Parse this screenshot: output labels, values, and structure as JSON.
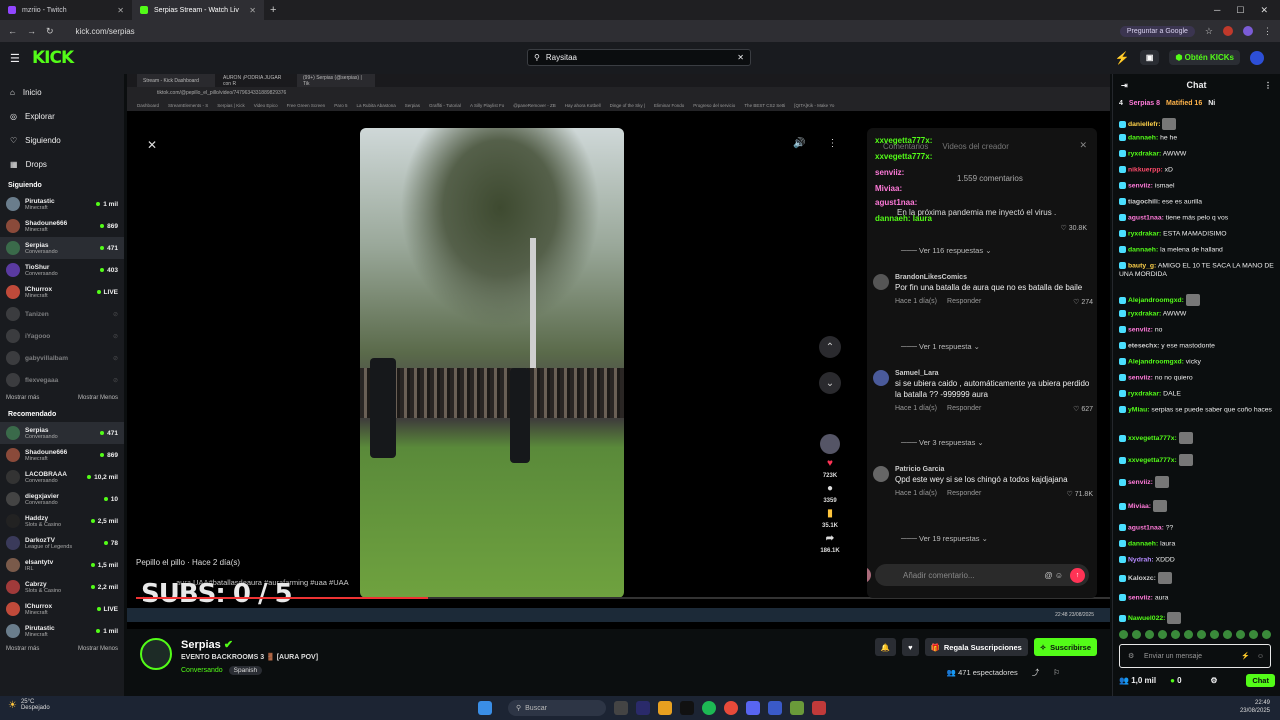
{
  "browser": {
    "tabs": [
      {
        "label": "mzriio - Twitch",
        "color": "#9146ff"
      },
      {
        "label": "Serpias Stream - Watch Liv",
        "color": "#53fc18"
      }
    ],
    "url": "kick.com/serpias",
    "google_label": "Preguntar a Google"
  },
  "kick": {
    "logo": "KICK",
    "search_value": "Raysitaa",
    "get_kicks": "Obtén KICKs"
  },
  "sidebar": {
    "nav": [
      {
        "label": "Inicio",
        "icon": "home-icon"
      },
      {
        "label": "Explorar",
        "icon": "compass-icon"
      },
      {
        "label": "Siguiendo",
        "icon": "heart-icon"
      },
      {
        "label": "Drops",
        "icon": "gift-icon"
      }
    ],
    "following_title": "Siguiendo",
    "following": [
      {
        "name": "Pirutastic",
        "cat": "Minecraft",
        "viewers": "1 mil",
        "color": "#6a7d8c",
        "dim": false
      },
      {
        "name": "Shadoune666",
        "cat": "Minecraft",
        "viewers": "869",
        "color": "#8a4a3a",
        "dim": false
      },
      {
        "name": "Serpias",
        "cat": "Conversando",
        "viewers": "471",
        "color": "#3a6a4a",
        "dim": false,
        "sel": true
      },
      {
        "name": "TioShur",
        "cat": "Conversando",
        "viewers": "403",
        "color": "#5a3aa0",
        "dim": false
      },
      {
        "name": "IChurrox",
        "cat": "Minecraft",
        "viewers": "LIVE",
        "color": "#c04a3a",
        "dim": false
      },
      {
        "name": "Tanizen",
        "cat": "",
        "viewers": "",
        "color": "#666",
        "dim": true
      },
      {
        "name": "iYagooo",
        "cat": "",
        "viewers": "",
        "color": "#666",
        "dim": true
      },
      {
        "name": "gabyvillalbam",
        "cat": "",
        "viewers": "",
        "color": "#666",
        "dim": true
      },
      {
        "name": "flexvegaaa",
        "cat": "",
        "viewers": "",
        "color": "#666",
        "dim": true
      }
    ],
    "more": "Mostrar más",
    "less": "Mostrar Menos",
    "recommended_title": "Recomendado",
    "recommended": [
      {
        "name": "Serpias",
        "cat": "Conversando",
        "viewers": "471",
        "color": "#3a6a4a",
        "sel": true
      },
      {
        "name": "Shadoune666",
        "cat": "Minecraft",
        "viewers": "869",
        "color": "#8a4a3a"
      },
      {
        "name": "LACOBRAAA",
        "cat": "Conversando",
        "viewers": "10,2 mil",
        "color": "#333"
      },
      {
        "name": "diegxjavier",
        "cat": "Conversando",
        "viewers": "10",
        "color": "#444"
      },
      {
        "name": "Haddzy",
        "cat": "Slots & Casino",
        "viewers": "2,5 mil",
        "color": "#222"
      },
      {
        "name": "DarkozTV",
        "cat": "League of Legends",
        "viewers": "78",
        "color": "#3a3a5a"
      },
      {
        "name": "elsantytv",
        "cat": "IRL",
        "viewers": "1,5 mil",
        "color": "#7a5a4a"
      },
      {
        "name": "Cabrzy",
        "cat": "Slots & Casino",
        "viewers": "2,2 mil",
        "color": "#a03a3a"
      },
      {
        "name": "IChurrox",
        "cat": "Minecraft",
        "viewers": "LIVE",
        "color": "#c04a3a"
      },
      {
        "name": "Pirutastic",
        "cat": "Minecraft",
        "viewers": "1 mil",
        "color": "#6a7d8c"
      }
    ]
  },
  "inner": {
    "tabs": [
      "Stream - Kick Dashboard",
      "AURON ¡PODRIA JUGAR con R",
      "(99+) Serpias (@serpias) | Tik"
    ],
    "url": "tiktok.com/@pepillo_el_pillo/video/7479634331889829376",
    "bookmarks": [
      "Dashboard",
      "StreamElements - S",
      "Serpias | Kick",
      "Video Epico",
      "Free Green Screen",
      "Paro 5",
      "La Rubita Abastona",
      "Serpias",
      "Graffiti - Tutorial",
      "A Silly Playlist Fo",
      "@paneRemover - ZB",
      "Hay ahora Kotbell",
      "Dinge of the Sky |",
      "Eliminar Fondo",
      "Progreso del servicio",
      "The BEST CS2 Setti",
      "[QITA]Kik - Make Yo"
    ]
  },
  "video": {
    "author": "Pepillo el pillo · Hace 2 día(s)",
    "caption": "aura UAA#batallasdeaura #aurafarming #uaa #UAA",
    "subs_overlay": "SUBS: 0 / 5",
    "likes": "723K",
    "comments_count": "3359",
    "saves": "35.1K",
    "shares": "186.1K",
    "mini_clock": "22:48 23/08/2025"
  },
  "comments_panel": {
    "tab_comments": "Comentarios",
    "tab_creator": "Videos del creador",
    "total": "1.559 comentarios",
    "overlay": [
      {
        "user": "xxvegetta777x:",
        "color": "#53fc18"
      },
      {
        "user": "xxvegetta777x:",
        "color": "#53fc18"
      },
      {
        "user": "senviiz:",
        "color": "#ff7ad9"
      },
      {
        "user": "Miviaa:",
        "color": "#ff7ad9"
      },
      {
        "user": "agust1naa:",
        "color": "#ff7ad9"
      },
      {
        "user": "dannaeh: laura",
        "color": "#53fc18"
      }
    ],
    "first_text": "En la próxima pandemia me inyectó el virus .",
    "first_like": "30.8K",
    "items": [
      {
        "replies": "Ver 116 respuestas"
      },
      {
        "user": "BrandonLikesComics",
        "text": "Por fin una batalla de aura que no es batalla de baile",
        "time": "Hace 1 día(s)",
        "reply": "Responder",
        "likes": "274",
        "more": "Ver 1 respuesta"
      },
      {
        "user": "Samuel_Lara",
        "text": "si se ubiera caido , automáticamente ya ubiera perdido la batalla ?? -999999 aura",
        "time": "Hace 1 día(s)",
        "reply": "Responder",
        "likes": "627",
        "more": "Ver 3 respuestas"
      },
      {
        "user": "Patricio Garcia",
        "text": "Qpd este wey si se los chingó a todos kajdjajana",
        "time": "Hace 1 día(s)",
        "reply": "Responder",
        "likes": "71.8K",
        "more": "Ver 19 respuestas"
      }
    ],
    "input_placeholder": "Añadir comentario..."
  },
  "stream": {
    "name": "Serpias",
    "title": "EVENTO BACKROOMS 3 🚪 [AURA POV]",
    "category": "Conversando",
    "language": "Spanish",
    "gift_subs": "Regala Suscripciones",
    "subscribe": "Suscribirse",
    "viewers": "471 espectadores"
  },
  "chat": {
    "title": "Chat",
    "pinned": [
      {
        "text": "4",
        "color": "#efeff1"
      },
      {
        "text": "Serpias 8",
        "color": "#ff7ad9"
      },
      {
        "text": "Matified 16",
        "color": "#ffb34a"
      },
      {
        "text": "Ni",
        "color": "#efeff1"
      }
    ],
    "messages": [
      {
        "user": "daniellefr:",
        "text": "",
        "color": "#ffd24a",
        "emote": true
      },
      {
        "user": "dannaeh:",
        "text": "he he",
        "color": "#53fc18"
      },
      {
        "user": "ryxdrakar:",
        "text": "AWWW",
        "color": "#53fc18"
      },
      {
        "user": "nikkuerpp:",
        "text": "xD",
        "color": "#ff4a6a"
      },
      {
        "user": "senviiz:",
        "text": "ismael",
        "color": "#ff7ad9"
      },
      {
        "user": "tiagochili:",
        "text": "ese es aurilla",
        "color": "#d0d0d0"
      },
      {
        "user": "agust1naa:",
        "text": "tiene más pelo q vos",
        "color": "#ff7ad9"
      },
      {
        "user": "ryxdrakar:",
        "text": "ESTA MAMADISIMO",
        "color": "#53fc18"
      },
      {
        "user": "dannaeh:",
        "text": "la melena de halland",
        "color": "#53fc18"
      },
      {
        "user": "bauty_g:",
        "text": "AMIGO EL 10 TE SACA LA MANO DE UNA MORDIDA",
        "color": "#ffd24a"
      },
      {
        "user": "Alejandroomgxd:",
        "text": "",
        "color": "#53fc18",
        "emote": true
      },
      {
        "user": "ryxdrakar:",
        "text": "AWWW",
        "color": "#53fc18"
      },
      {
        "user": "senviiz:",
        "text": "no",
        "color": "#ff7ad9"
      },
      {
        "user": "etesechx:",
        "text": "y ese mastodonte",
        "color": "#d0d0d0"
      },
      {
        "user": "Alejandroomgxd:",
        "text": "vicky",
        "color": "#53fc18"
      },
      {
        "user": "senviiz:",
        "text": "no no quiero",
        "color": "#ff7ad9"
      },
      {
        "user": "ryxdrakar:",
        "text": "DALE",
        "color": "#53fc18"
      },
      {
        "user": "yMiau:",
        "text": "serpias se puede saber que coño haces",
        "color": "#53fc18"
      },
      {
        "user": "xxvegetta777x:",
        "text": "",
        "color": "#53fc18",
        "emote": true
      },
      {
        "user": "xxvegetta777x:",
        "text": "",
        "color": "#53fc18",
        "emote": true
      },
      {
        "user": "senviiz:",
        "text": "",
        "color": "#ff7ad9",
        "emote": true
      },
      {
        "user": "Miviaa:",
        "text": "",
        "color": "#ff7ad9",
        "emote": true
      },
      {
        "user": "agust1naa:",
        "text": "??",
        "color": "#ff7ad9"
      },
      {
        "user": "dannaeh:",
        "text": "laura",
        "color": "#53fc18"
      },
      {
        "user": "Nydrah:",
        "text": "XDDD",
        "color": "#b48aff"
      },
      {
        "user": "Kaloxzc:",
        "text": "",
        "color": "#d0d0d0",
        "emote": true
      },
      {
        "user": "senviiz:",
        "text": "aura",
        "color": "#ff7ad9"
      },
      {
        "user": "Nawuel022:",
        "text": "",
        "color": "#53fc18",
        "emote": true
      }
    ],
    "input_placeholder": "Enviar un mensaje",
    "followers": "1,0 mil",
    "points": "0",
    "send": "Chat"
  },
  "taskbar": {
    "temp": "25°C",
    "weather": "Despejado",
    "search": "Buscar",
    "time": "22:49",
    "date": "23/08/2025"
  }
}
